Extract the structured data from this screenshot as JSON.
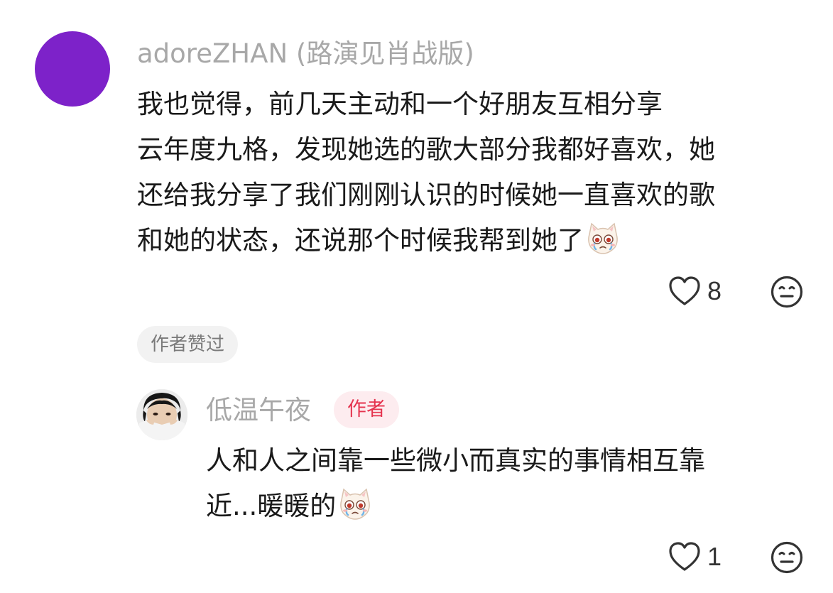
{
  "comment": {
    "username": "adoreZHAN (路演见肖战版)",
    "lines": [
      "我也觉得，前几天主动和一个好朋友互相分享",
      "云年度九格，发现她选的歌大部分我都好喜欢，她",
      "还给我分享了我们刚刚认识的时候她一直喜欢的歌",
      "和她的状态，还说那个时候我帮到她了"
    ],
    "emoji": "crying-cat-icon",
    "like_count": "8",
    "author_liked_label": "作者赞过"
  },
  "reply": {
    "username": "低温午夜",
    "badge": "作者",
    "lines": [
      "人和人之间靠一些微小而真实的事情相互靠",
      "近...暖暖的"
    ],
    "emoji": "crying-cat-icon",
    "like_count": "1"
  },
  "colors": {
    "avatar": "#7d22c9",
    "badge_text": "#e5344f",
    "badge_bg": "#fdecef"
  }
}
